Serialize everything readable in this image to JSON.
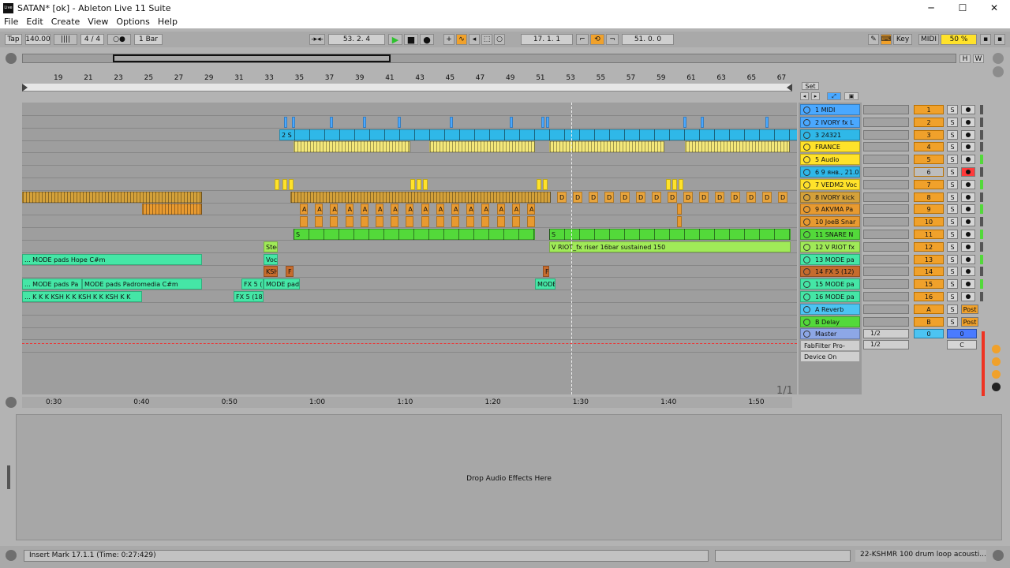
{
  "window": {
    "title": "SATAN*  [ok] - Ableton Live 11 Suite",
    "logo": "Live",
    "minimize": "─",
    "maximize": "☐",
    "close": "✕"
  },
  "menu": [
    "File",
    "Edit",
    "Create",
    "View",
    "Options",
    "Help"
  ],
  "transport": {
    "tap": "Tap",
    "tempo": "140.00",
    "nudge": "||||",
    "signature": "4 / 4",
    "metro": "○●",
    "quant": "1 Bar",
    "follow": "-▸◂-",
    "arrangement_pos": "53.  2.  4",
    "loop_start": "17.  1.  1",
    "loop_length": "51.  0.  0",
    "key": "Key",
    "midi": "MIDI",
    "cpu": "50 %"
  },
  "overview_buttons": {
    "h": "H",
    "w": "W"
  },
  "ruler_bars": [
    "19",
    "21",
    "23",
    "25",
    "27",
    "29",
    "31",
    "33",
    "35",
    "37",
    "39",
    "41",
    "43",
    "45",
    "47",
    "49",
    "51",
    "53",
    "55",
    "57",
    "59",
    "61",
    "63",
    "65",
    "67"
  ],
  "time_labels": [
    "0:30",
    "0:40",
    "0:50",
    "1:00",
    "1:10",
    "1:20",
    "1:30",
    "1:40",
    "1:50"
  ],
  "set_label": "Set",
  "page_indicator": "1/1",
  "tracks": [
    {
      "name": "1 MIDI",
      "color": "#4aa8ff",
      "num": "1"
    },
    {
      "name": "2 IVORY  fx  L",
      "color": "#4aa8ff",
      "num": "2"
    },
    {
      "name": "3 24321",
      "color": "#2fb8e8",
      "num": "3"
    },
    {
      "name": "FRANCE",
      "color": "#ffe22a",
      "num": "4"
    },
    {
      "name": "5 Audio",
      "color": "#ffe22a",
      "num": "5"
    },
    {
      "name": "6 9 янв., 21.0",
      "color": "#2fb8e8",
      "num": "6",
      "armed": true
    },
    {
      "name": "7 VEDM2 Voc",
      "color": "#ffe22a",
      "num": "7"
    },
    {
      "name": "8 IVORY  kick",
      "color": "#d4a13a",
      "num": "8"
    },
    {
      "name": "9 AKVMA  Pa",
      "color": "#e89a30",
      "num": "9"
    },
    {
      "name": "10 JoeB  Snar",
      "color": "#e89a30",
      "num": "10"
    },
    {
      "name": "11 SNARE  N",
      "color": "#53d93a",
      "num": "11"
    },
    {
      "name": "12 V  RIOT  fx",
      "color": "#a0ea58",
      "num": "12"
    },
    {
      "name": "13 MODE  pa",
      "color": "#45e6a6",
      "num": "13"
    },
    {
      "name": "14 FX 5  (12)",
      "color": "#c66b2d",
      "num": "14"
    },
    {
      "name": "15 MODE  pa",
      "color": "#45e6a6",
      "num": "15"
    },
    {
      "name": "16 MODE  pa",
      "color": "#45e6a6",
      "num": "16"
    }
  ],
  "returns": [
    {
      "name": "A Reverb",
      "color": "#4cc4f2",
      "num": "A",
      "post": "Post"
    },
    {
      "name": "B Delay",
      "color": "#53d93a",
      "num": "B",
      "post": "Post"
    }
  ],
  "master": {
    "name": "Master",
    "color": "#8da7e6",
    "routing": "1/2",
    "routing2": "1/2",
    "plugin": "FabFilter Pro-",
    "device": "Device On",
    "vol": "0",
    "pan": "0",
    "c": "C"
  },
  "solo": "S",
  "clips": {
    "audio3": "2  S",
    "riser": "V  RIOT_fx  riser  16bar  sustained  150",
    "pads_hope": "... MODE  pads  Hope  C#m",
    "pads_padro": "... MODE  pads  Pa",
    "pads_padro2": "MODE  pads  Padromedia  C#m",
    "fx5_18": "FX 5  (18)",
    "fx5_a": "FX 5  (",
    "mode_pad": "MODE  pad",
    "mode_b": "MODE",
    "kick_row": "... K  K  K  KSH  K  K  KSH  K  K  KSH  K  K",
    "ste": "Stee",
    "voc": "Voca",
    "ksh": "KSH",
    "f": "F",
    "snare_label": "S",
    "drum_label": "D",
    "pad_label": "A",
    "v_label": "V",
    "dc_label": "Di",
    "fx_label": "F"
  },
  "device_panel": {
    "drop_text": "Drop Audio Effects Here"
  },
  "status": {
    "message": "Insert Mark 17.1.1 (Time: 0:27:429)",
    "clip_name": "22-KSHMR  100  drum  loop  acousti..."
  }
}
